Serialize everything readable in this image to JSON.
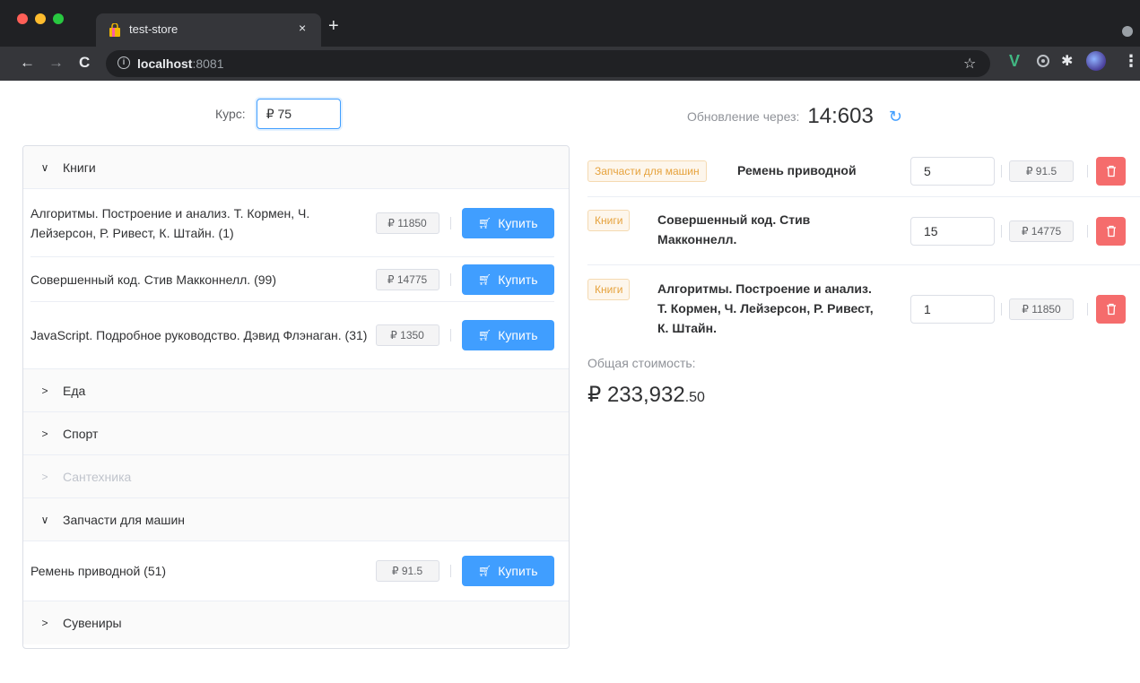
{
  "browser": {
    "tab_title": "test-store",
    "tab_close": "×",
    "new_tab": "+",
    "url_host": "localhost",
    "url_port": ":8081"
  },
  "rate": {
    "label": "Курс:",
    "value": "₽ 75"
  },
  "timer": {
    "label": "Обновление через:",
    "value": "14:603"
  },
  "buy_label": "Купить",
  "categories": [
    {
      "name": "Книги",
      "expanded": true,
      "products": [
        {
          "name": "Алгоритмы. Построение и анализ. Т. Кормен, Ч. Лейзерсон, Р. Ривест, К. Штайн. (1)",
          "price": "₽ 11850"
        },
        {
          "name": "Совершенный код. Стив Макконнелл. (99)",
          "price": "₽ 14775"
        },
        {
          "name": "JavaScript. Подробное руководство. Дэвид Флэнаган. (31)",
          "price": "₽ 1350"
        }
      ]
    },
    {
      "name": "Еда",
      "expanded": false
    },
    {
      "name": "Спорт",
      "expanded": false
    },
    {
      "name": "Сантехника",
      "expanded": false,
      "disabled": true
    },
    {
      "name": "Запчасти для машин",
      "expanded": true,
      "products": [
        {
          "name": "Ремень приводной (51)",
          "price": "₽ 91.5"
        }
      ]
    },
    {
      "name": "Сувениры",
      "expanded": false
    }
  ],
  "cart": [
    {
      "category": "Запчасти для машин",
      "name": "Ремень приводной",
      "qty": "5",
      "price": "₽ 91.5"
    },
    {
      "category": "Книги",
      "name": "Совершенный код. Стив Макконнелл.",
      "qty": "15",
      "price": "₽ 14775"
    },
    {
      "category": "Книги",
      "name": "Алгоритмы. Построение и анализ. Т. Кормен, Ч. Лейзерсон, Р. Ривест, К. Штайн.",
      "qty": "1",
      "price": "₽ 11850"
    }
  ],
  "total": {
    "label": "Общая стоимость:",
    "value_main": "₽ 233,932",
    "value_cents": ".50"
  },
  "colors": {
    "primary": "#409eff",
    "danger": "#f56c6c",
    "warning_text": "#e6a23c",
    "warning_bg": "#fdf6ec"
  }
}
